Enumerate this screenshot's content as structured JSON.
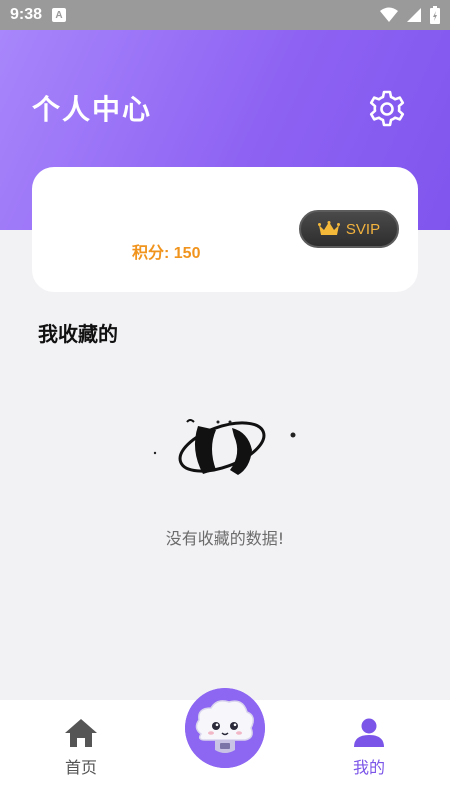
{
  "status_bar": {
    "time": "9:38",
    "notification_icon_letter": "A"
  },
  "header": {
    "title": "个人中心"
  },
  "user_card": {
    "points_text": "积分: 150",
    "badge_label": "SVIP"
  },
  "favorites": {
    "section_title": "我收藏的",
    "empty_text": "没有收藏的数据!"
  },
  "tab_bar": {
    "tabs": [
      {
        "label": "首页",
        "icon": "home-icon",
        "active": false
      },
      {
        "label": "我的",
        "icon": "user-icon",
        "active": true
      }
    ],
    "center_button_icon": "cloud-mascot-icon"
  },
  "colors": {
    "accent": "#7b55e8",
    "points": "#f0941e",
    "badge_gold": "#f3b33e"
  }
}
